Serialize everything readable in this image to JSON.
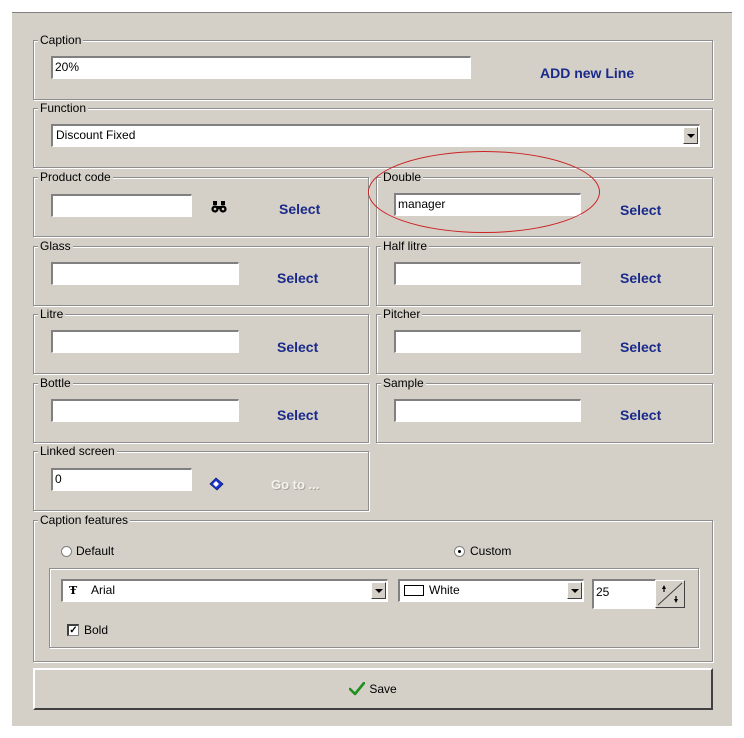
{
  "caption": {
    "legend": "Caption",
    "value": "20%",
    "add_line_label": "ADD new Line"
  },
  "function": {
    "legend": "Function",
    "selected": "Discount Fixed"
  },
  "product_code": {
    "legend": "Product code",
    "value": "",
    "select_label": "Select"
  },
  "double": {
    "legend": "Double",
    "value": "manager",
    "select_label": "Select"
  },
  "glass": {
    "legend": "Glass",
    "value": "",
    "select_label": "Select"
  },
  "half_litre": {
    "legend": "Half litre",
    "value": "",
    "select_label": "Select"
  },
  "litre": {
    "legend": "Litre",
    "value": "",
    "select_label": "Select"
  },
  "pitcher": {
    "legend": "Pitcher",
    "value": "",
    "select_label": "Select"
  },
  "bottle": {
    "legend": "Bottle",
    "value": "",
    "select_label": "Select"
  },
  "sample": {
    "legend": "Sample",
    "value": "",
    "select_label": "Select"
  },
  "linked_screen": {
    "legend": "Linked screen",
    "value": "0",
    "goto_label": "Go to ..."
  },
  "caption_features": {
    "legend": "Caption features",
    "default_label": "Default",
    "custom_label": "Custom",
    "selected_mode": "Custom",
    "font": "Arial",
    "font_icon": "truetype-font-icon",
    "color_name": "White",
    "color_swatch": "#ffffff",
    "size": "25",
    "bold_label": "Bold",
    "bold_checked": true
  },
  "save": {
    "label": "Save",
    "icon": "checkmark-icon",
    "icon_color": "#1f8f1f"
  },
  "colors": {
    "panel_bg": "#d4d0c8",
    "link": "#1a2a8a",
    "highlight": "#cc2222"
  }
}
